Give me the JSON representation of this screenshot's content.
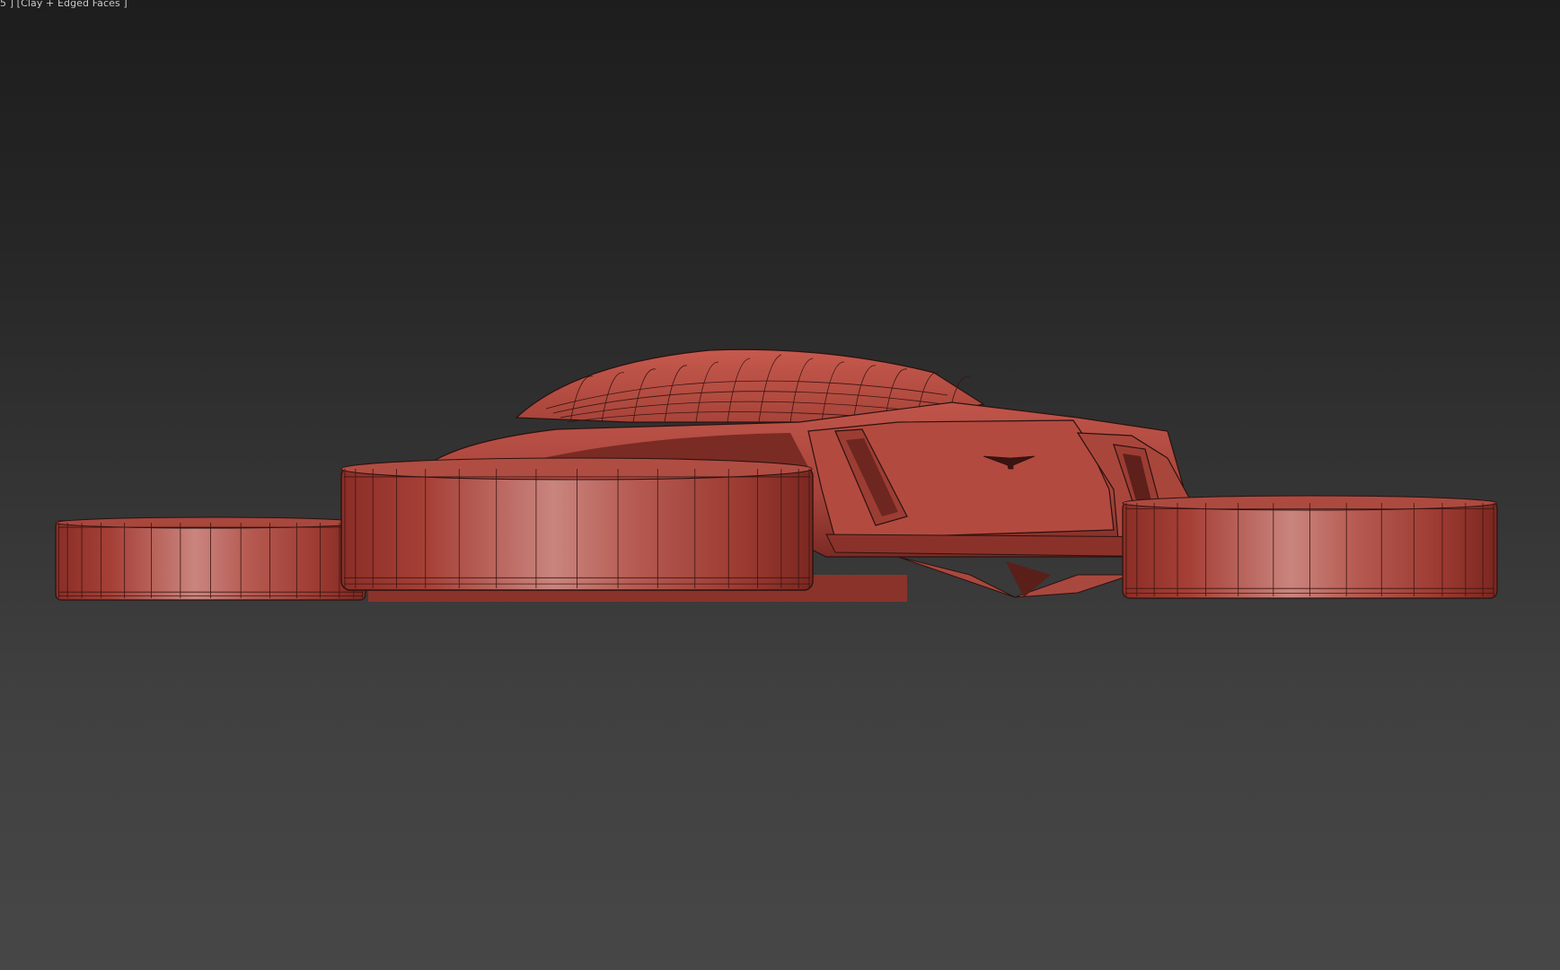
{
  "viewport": {
    "label": "5 ] [Clay + Edged Faces ]",
    "display_mode": "Clay + Edged Faces"
  },
  "colors": {
    "background_top": "#1d1d1d",
    "background_bottom": "#474747",
    "clay_base": "#b24a3c",
    "clay_highlight": "#d9908a",
    "clay_shadow": "#6e2620",
    "wire_edge": "#2a1210",
    "label_text": "#c8c8c8"
  },
  "scene": {
    "object": "hover-vehicle",
    "parts": [
      "body-shell",
      "canopy",
      "front-fan-left-outer",
      "front-fan-left-inner",
      "front-fan-right",
      "side-intake-left",
      "side-intake-right",
      "underside-strut",
      "emblem"
    ]
  }
}
